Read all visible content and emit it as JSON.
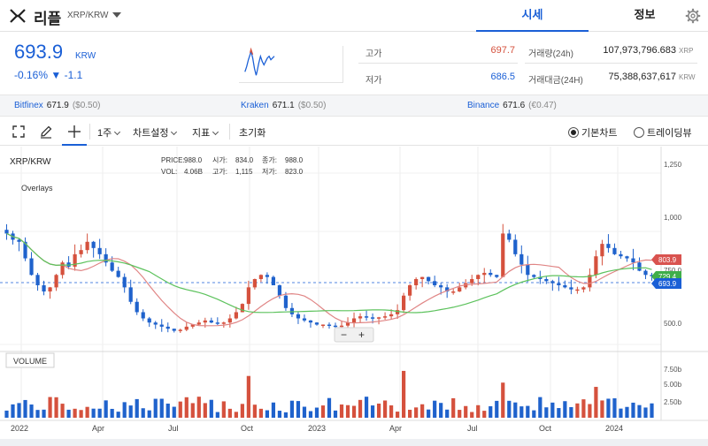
{
  "header": {
    "coin_name": "리플",
    "pair": "XRP/KRW",
    "tabs": [
      {
        "label": "시세"
      },
      {
        "label": "정보"
      }
    ]
  },
  "price": {
    "current": "693.9",
    "unit": "KRW",
    "change": "-0.16% ▼ -1.1",
    "high_label": "고가",
    "high": "697.7",
    "low_label": "저가",
    "low": "686.5",
    "volume_label": "거래량(24h)",
    "volume": "107,973,796.683",
    "volume_unit": "XRP",
    "value_label": "거래대금(24H)",
    "value": "75,388,637,617",
    "value_unit": "KRW"
  },
  "exchanges": [
    {
      "name": "Bitfinex",
      "price": "671.9",
      "diff": "($0.50)"
    },
    {
      "name": "Kraken",
      "price": "671.1",
      "diff": "($0.50)"
    },
    {
      "name": "Binance",
      "price": "671.6",
      "diff": "(€0.47)"
    }
  ],
  "toolbar": {
    "interval": "1주",
    "chart_settings": "차트설정",
    "indicators": "지표",
    "reset": "초기화",
    "basic_chart": "기본차트",
    "trading_view": "트레이딩뷰"
  },
  "chart": {
    "symbol": "XRP/KRW",
    "overlays": "Overlays",
    "ohlc_info": {
      "price_label": "PRICE:",
      "price": "988.0",
      "open_label": "시가:",
      "open": "834.0",
      "close_label": "종가:",
      "close": "988.0",
      "vol_label": "VOL:",
      "vol": "4.06B",
      "high_label": "고가:",
      "high": "1,115",
      "low_label": "저가:",
      "low": "823.0"
    },
    "volume_label": "VOLUME",
    "y_ticks": [
      "1,250",
      "1,000",
      "750.0",
      "500.0"
    ],
    "vol_ticks": [
      "7.50b",
      "5.00b",
      "2.50b"
    ],
    "x_ticks": [
      "2022",
      "Apr",
      "Jul",
      "Oct",
      "2023",
      "Apr",
      "Jul",
      "Oct",
      "2024"
    ],
    "tags": [
      {
        "text": "803.9",
        "color": "#d9534f"
      },
      {
        "text": "729.4",
        "color": "#3fae49"
      },
      {
        "text": "693.9",
        "color": "#1a5fd6"
      }
    ],
    "zoom_minus": "−",
    "zoom_plus": "+",
    "colors": {
      "up": "#d5513d",
      "down": "#1f62cc",
      "ma_red": "#e88a8a",
      "ma_green": "#5cc25c"
    }
  },
  "chart_data": {
    "type": "candlestick",
    "price_ylim": [
      330,
      1320
    ],
    "weekly_closes": [
      900,
      870,
      860,
      780,
      700,
      650,
      620,
      640,
      700,
      760,
      740,
      800,
      820,
      860,
      830,
      800,
      760,
      720,
      690,
      640,
      570,
      520,
      490,
      470,
      460,
      450,
      440,
      430,
      435,
      450,
      460,
      470,
      480,
      470,
      465,
      470,
      490,
      520,
      560,
      640,
      680,
      700,
      690,
      650,
      600,
      540,
      510,
      490,
      480,
      470,
      460,
      460,
      455,
      450,
      455,
      470,
      490,
      500,
      495,
      490,
      495,
      500,
      510,
      530,
      600,
      650,
      680,
      690,
      670,
      650,
      640,
      620,
      620,
      640,
      660,
      680,
      700,
      710,
      700,
      690,
      900,
      870,
      800,
      750,
      700,
      690,
      680,
      670,
      660,
      650,
      640,
      630,
      630,
      640,
      700,
      790,
      850,
      830,
      800,
      790,
      780,
      760,
      720,
      700,
      693.9
    ],
    "volumes": []
  }
}
